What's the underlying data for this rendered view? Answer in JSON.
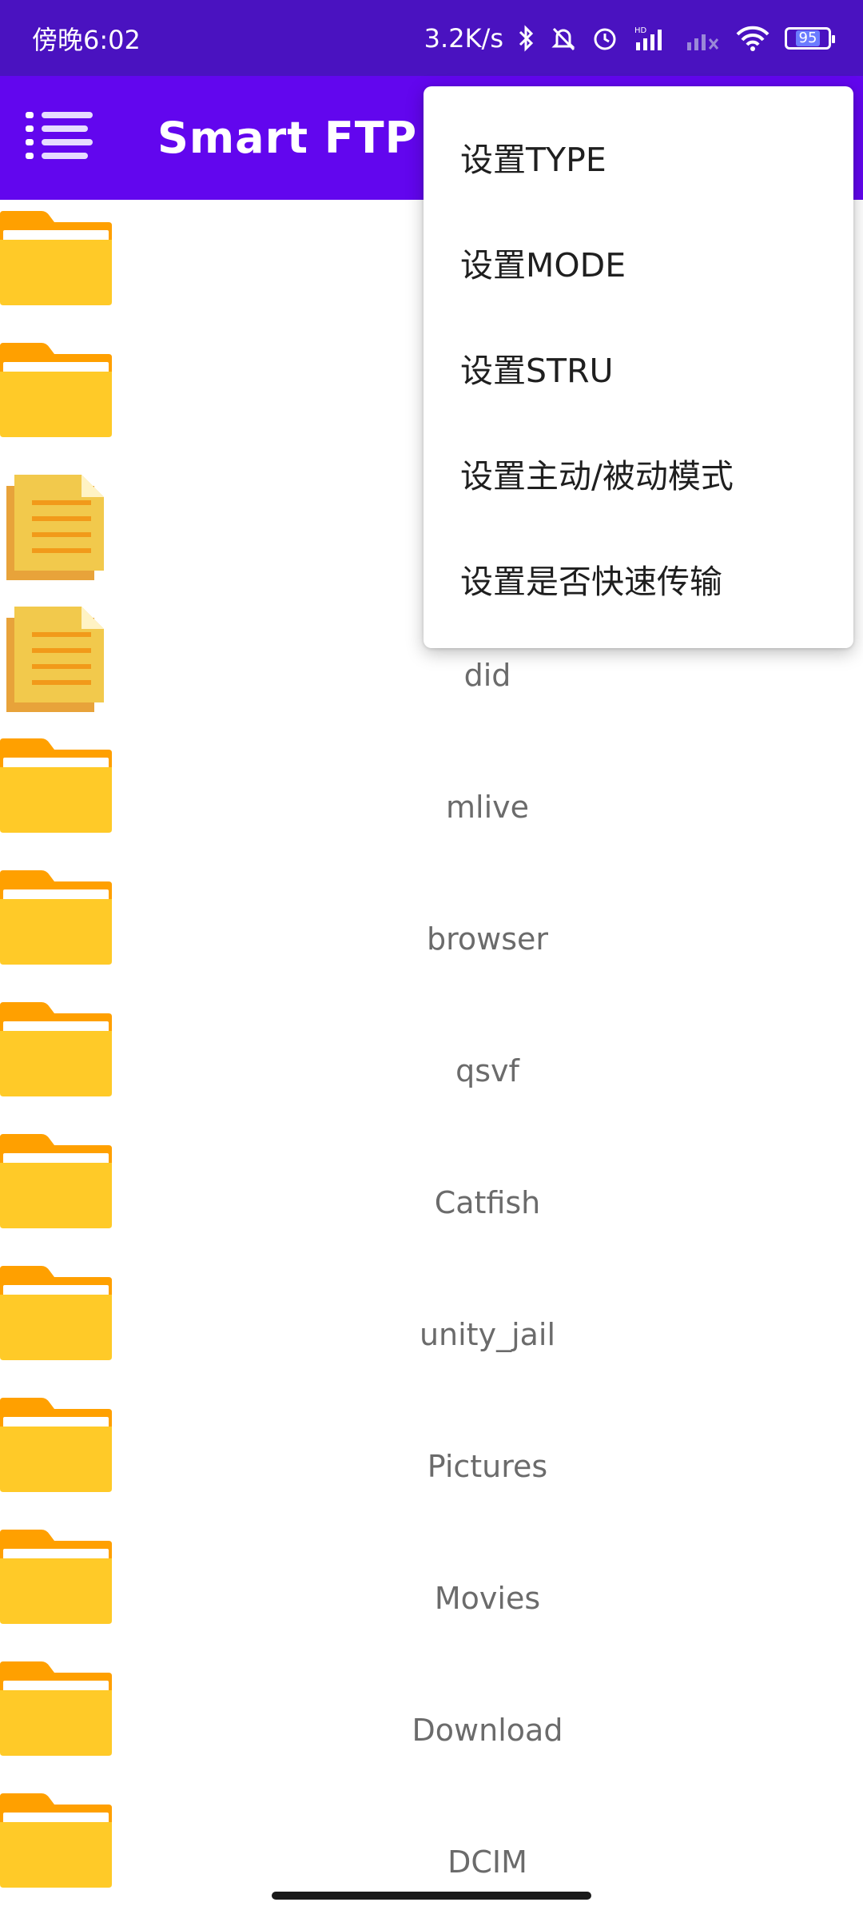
{
  "status_bar": {
    "time": "傍晚6:02",
    "net_speed": "3.2K/s",
    "battery": "95",
    "icons": [
      "bluetooth-icon",
      "mute-icon",
      "alarm-icon",
      "signal-hd-icon",
      "signal-weak-icon",
      "wifi-icon",
      "battery-icon"
    ]
  },
  "app_bar": {
    "title": "Smart FTP",
    "menu_icon": "list-menu-icon"
  },
  "popup_menu": {
    "items": [
      {
        "label": "设置TYPE"
      },
      {
        "label": "设置MODE"
      },
      {
        "label": "设置STRU"
      },
      {
        "label": "设置主动/被动模式"
      },
      {
        "label": "设置是否快速传输"
      }
    ]
  },
  "files": [
    {
      "name": "",
      "type": "folder"
    },
    {
      "name": "",
      "type": "folder"
    },
    {
      "name": "",
      "type": "file"
    },
    {
      "name": "did",
      "type": "file"
    },
    {
      "name": "mlive",
      "type": "folder"
    },
    {
      "name": "browser",
      "type": "folder"
    },
    {
      "name": "qsvf",
      "type": "folder"
    },
    {
      "name": "Catfish",
      "type": "folder"
    },
    {
      "name": "unity_jail",
      "type": "folder"
    },
    {
      "name": "Pictures",
      "type": "folder"
    },
    {
      "name": "Movies",
      "type": "folder"
    },
    {
      "name": "Download",
      "type": "folder"
    },
    {
      "name": "DCIM",
      "type": "folder"
    }
  ],
  "colors": {
    "status_bar": "#4a12c0",
    "app_bar": "#6206ee",
    "folder_yellow": "#ffca28",
    "folder_orange": "#ffa000",
    "file_yellow": "#f2c94c",
    "file_orange": "#e6a43a"
  }
}
